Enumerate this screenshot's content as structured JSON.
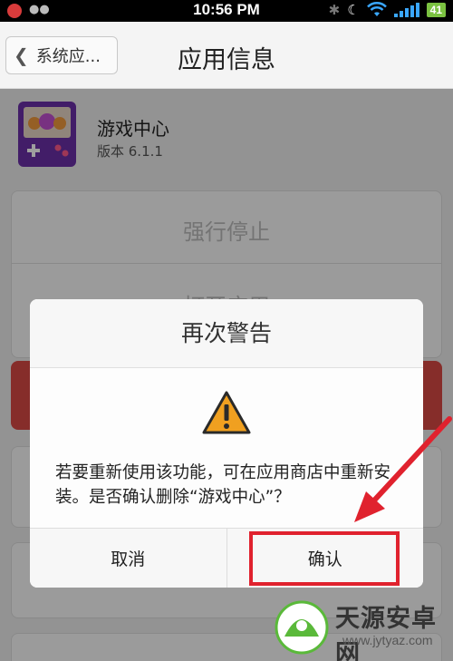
{
  "status_bar": {
    "time": "10:56 PM",
    "battery": "41"
  },
  "title_bar": {
    "back_label": "系统应...",
    "title": "应用信息"
  },
  "app": {
    "name": "游戏中心",
    "version": "版本 6.1.1"
  },
  "background": {
    "force_stop": "强行停止",
    "open_app": "打开应用"
  },
  "dialog": {
    "title": "再次警告",
    "message": "若要重新使用该功能，可在应用商店中重新安装。是否确认删除“游戏中心”？",
    "cancel_label": "取消",
    "confirm_label": "确认"
  },
  "watermark": {
    "name": "天源安卓网",
    "url": "www.jytyaz.com"
  },
  "colors": {
    "annotation_red": "#e0222e",
    "warning_orange": "#f0a020",
    "app_icon_purple": "#6b2fa8"
  }
}
